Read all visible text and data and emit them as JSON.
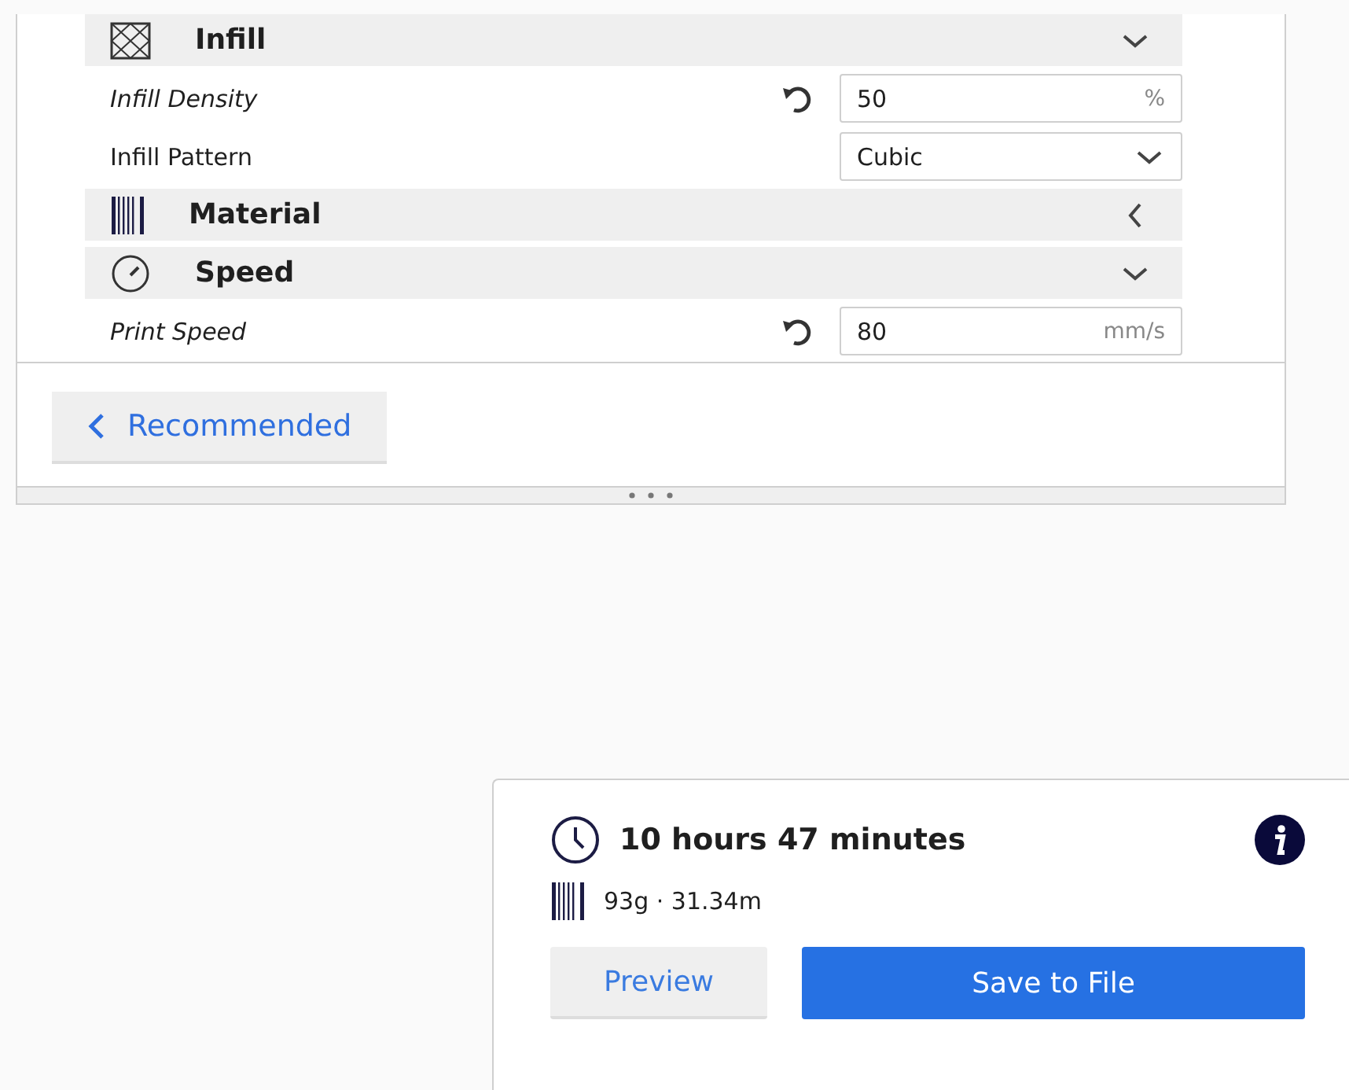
{
  "settings": [
    {
      "kind": "header",
      "title": "Infill",
      "expanded": true
    },
    {
      "kind": "number",
      "label": "Infill Density",
      "modified": true,
      "value": "50",
      "unit": "%"
    },
    {
      "kind": "dropdown",
      "label": "Infill Pattern",
      "modified": false,
      "value": "Cubic"
    },
    {
      "kind": "header",
      "title": "Material",
      "expanded": false
    },
    {
      "kind": "header",
      "title": "Speed",
      "expanded": true
    },
    {
      "kind": "number",
      "label": "Print Speed",
      "modified": true,
      "value": "80",
      "unit": "mm/s"
    }
  ],
  "mode_button": {
    "label": "Recommended"
  },
  "summary": {
    "time": "10 hours 47 minutes",
    "material": "93g · 31.34m",
    "buttons": [
      {
        "label": "Preview",
        "primary": false
      },
      {
        "label": "Save to File",
        "primary": true
      }
    ]
  }
}
